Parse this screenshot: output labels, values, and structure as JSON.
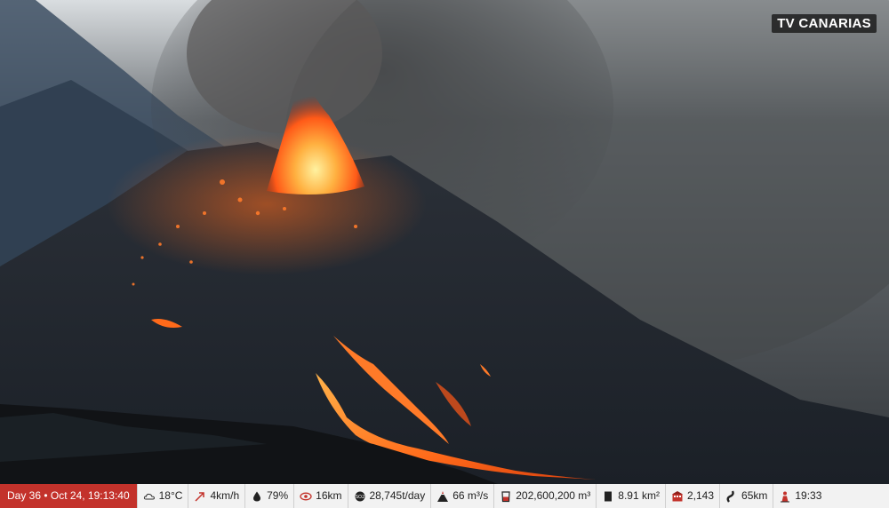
{
  "overlay": {
    "channel_logo": "TV CANARIAS"
  },
  "ticker": {
    "day_badge": "Day 36 • Oct 24, 19:13:40",
    "stats": [
      {
        "name": "temperature",
        "icon": "cloud-icon",
        "value": "18°C"
      },
      {
        "name": "wind",
        "icon": "wind-direction-icon",
        "value": "4km/h"
      },
      {
        "name": "humidity",
        "icon": "droplet-icon",
        "value": "79%"
      },
      {
        "name": "visibility",
        "icon": "eye-icon",
        "value": "16km"
      },
      {
        "name": "so2-emission",
        "icon": "gas-emission-icon",
        "value": "28,745t/day"
      },
      {
        "name": "lava-flow-rate",
        "icon": "volcano-icon",
        "value": "66 m³/s"
      },
      {
        "name": "lava-volume",
        "icon": "beaker-icon",
        "value": "202,600,200 m³"
      },
      {
        "name": "affected-area",
        "icon": "area-icon",
        "value": "8.91 km²"
      },
      {
        "name": "buildings-destroyed",
        "icon": "building-icon",
        "value": "2,143"
      },
      {
        "name": "road-length",
        "icon": "road-icon",
        "value": "65km"
      },
      {
        "name": "local-time",
        "icon": "person-icon",
        "value": "19:33"
      }
    ]
  },
  "colors": {
    "badge_red": "#c3322b",
    "ticker_bg": "#f2f2f2",
    "lava": "#ff6a1a"
  }
}
